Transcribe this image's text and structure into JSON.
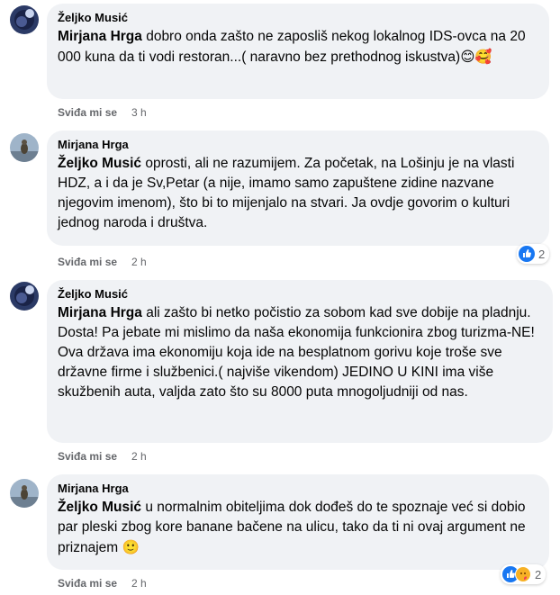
{
  "comments": [
    {
      "author": "Željko Musić",
      "mention": "Mirjana Hrga",
      "text": " dobro onda zašto ne zaposliš nekog lokalnog IDS-ovca na 20 000 kuna da ti vodi restoran...( naravno bez prethodnog iskustva)",
      "emoji": "😊🥰",
      "like_label": "Sviđa mi se",
      "time": "3 h",
      "reaction_count": ""
    },
    {
      "author": "Mirjana Hrga",
      "mention": "Željko Musić",
      "text": " oprosti, ali ne razumijem. Za početak, na Lošinju je na vlasti HDZ, a i da je Sv,Petar (a nije, imamo samo zapuštene zidine nazvane njegovim imenom), što bi to mijenjalo na stvari. Ja ovdje govorim o kulturi jednog naroda i društva.",
      "emoji": "",
      "like_label": "Sviđa mi se",
      "time": "2 h",
      "reaction_count": "2"
    },
    {
      "author": "Željko Musić",
      "mention": "Mirjana Hrga",
      "text": " ali zašto bi netko počistio za sobom kad sve dobije na pladnju. Dosta! Pa jebate mi mislimo da naša ekonomija funkcionira zbog turizma-NE! Ova država ima ekonomiju koja ide na besplatnom gorivu koje troše sve državne firme i službenici.( najviše vikendom) JEDINO U KINI ima više skužbenih auta, valjda zato što su 8000 puta mnogoljudniji od nas.",
      "emoji": "",
      "like_label": "Sviđa mi se",
      "time": "2 h",
      "reaction_count": ""
    },
    {
      "author": "Mirjana Hrga",
      "mention": "Željko Musić",
      "text": " u normalnim obiteljima dok dođeš do te spoznaje već si dobio par pleski zbog kore banane bačene na ulicu, tako da ti ni ovaj argument ne priznajem ",
      "emoji": "🙂",
      "like_label": "Sviđa mi se",
      "time": "2 h",
      "reaction_count": "2"
    }
  ],
  "colors": {
    "bubble": "#f0f2f5",
    "meta": "#65676b",
    "like_blue": "#1877f2"
  },
  "icons": [
    "avatar-zeljko",
    "avatar-mirjana",
    "like-reaction-icon",
    "care-reaction-icon"
  ]
}
